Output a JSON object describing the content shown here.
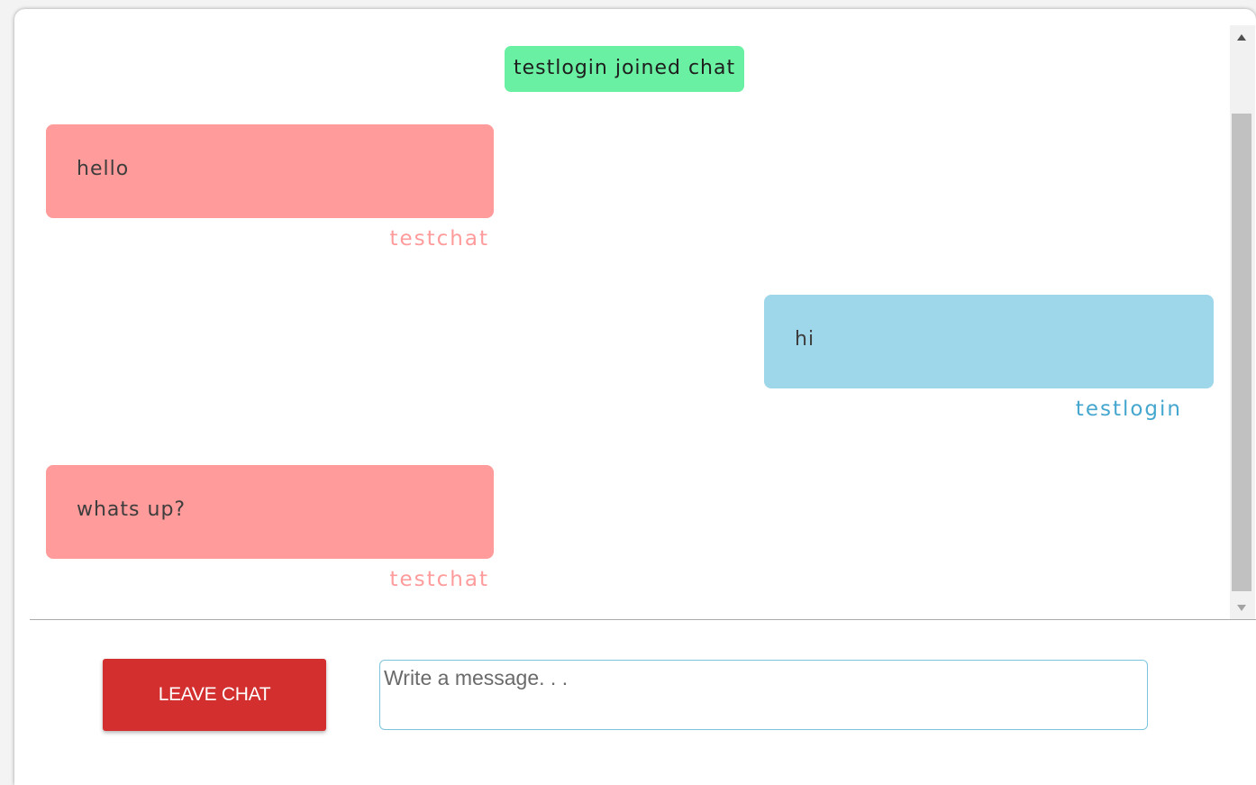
{
  "chat": {
    "system_message": "testlogin joined chat",
    "messages": [
      {
        "text": "hello",
        "sender": "testchat",
        "side": "other"
      },
      {
        "text": "hi",
        "sender": "testlogin",
        "side": "self"
      },
      {
        "text": "whats up?",
        "sender": "testchat",
        "side": "other"
      }
    ]
  },
  "footer": {
    "leave_button_label": "LEAVE CHAT",
    "message_placeholder": "Write a message. . .",
    "message_value": ""
  },
  "colors": {
    "system_badge": "#69f0a2",
    "other_bubble": "#ff9b9b",
    "self_bubble": "#9ed7ea",
    "self_sender": "#45a7cf",
    "leave_button": "#d32f2f",
    "input_border": "#7cc4de"
  },
  "icons": {
    "scroll_up": "triangle-up-icon",
    "scroll_down": "triangle-down-icon"
  }
}
